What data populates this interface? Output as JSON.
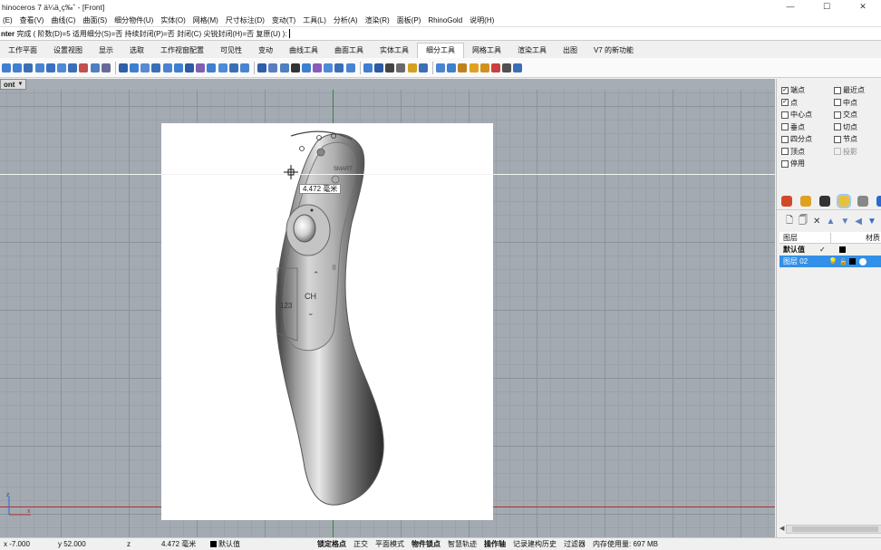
{
  "window": {
    "title": "hinoceros 7 ä¼ä¸ç‰ˆ - [Front]",
    "controls": {
      "minimize": "—",
      "maximize": "☐",
      "close": "✕"
    }
  },
  "menubar": [
    "(E)",
    "查看(V)",
    "曲线(C)",
    "曲面(S)",
    "细分物件(U)",
    "实体(O)",
    "网格(M)",
    "尺寸标注(D)",
    "变动(T)",
    "工具(L)",
    "分析(A)",
    "渲染(R)",
    "面板(P)",
    "RhinoGold",
    "说明(H)"
  ],
  "command": {
    "name": "nter",
    "text": " 完成 ( 阶数(D)=5 适用细分(S)=否 持续封闭(P)=否 封闭(C) 尖锐封闭(H)=否 复原(U) ):"
  },
  "tabs": [
    {
      "label": "工作平面",
      "active": false
    },
    {
      "label": "设置视图",
      "active": false
    },
    {
      "label": "显示",
      "active": false
    },
    {
      "label": "选取",
      "active": false
    },
    {
      "label": "工作视窗配置",
      "active": false
    },
    {
      "label": "可见性",
      "active": false
    },
    {
      "label": "变动",
      "active": false
    },
    {
      "label": "曲线工具",
      "active": false
    },
    {
      "label": "曲面工具",
      "active": false
    },
    {
      "label": "实体工具",
      "active": false
    },
    {
      "label": "细分工具",
      "active": true
    },
    {
      "label": "网格工具",
      "active": false
    },
    {
      "label": "渲染工具",
      "active": false
    },
    {
      "label": "出图",
      "active": false
    },
    {
      "label": "V7 的新功能",
      "active": false
    }
  ],
  "toolbar_icon_colors": [
    "#3f7fcf",
    "#3f7fcf",
    "#3b6fb5",
    "#4a84d0",
    "#3a70c0",
    "#4e8ad6",
    "#3b6fb5",
    "#c05050",
    "#4f7fc0",
    "#6a6a9a",
    "#2e5fa8",
    "#3f7fcf",
    "#5a8ad0",
    "#3b6fb5",
    "#4a84d0",
    "#3f7fcf",
    "#2d5aa0",
    "#8060b0",
    "#3f7fcf",
    "#4e8ad6",
    "#3b6fb5",
    "#4a84d0",
    "#2e5fa8",
    "#5a7fc0",
    "#4f7fc0",
    "#333333",
    "#3f7fcf",
    "#8a5ab8",
    "#4e8ad6",
    "#3b6fb5",
    "#4a84d0",
    "#3f7fcf",
    "#2d5aa0",
    "#444444",
    "#6a6a6a",
    "#d4a020",
    "#3b6fb5",
    "#4a84d0",
    "#3f7fcf",
    "#c08020",
    "#e0a020",
    "#d09020",
    "#c84040",
    "#505050",
    "#3b6fb5"
  ],
  "viewport": {
    "name": "ont",
    "tooltip": "4.472 毫米",
    "axis_labels": {
      "z": "z",
      "x": "x"
    }
  },
  "colors": {
    "viewport_bg": "#a3aab1",
    "axis_x": "#a83232",
    "axis_y": "#2f8a3a",
    "selection": "#3390e8"
  },
  "osnap": [
    {
      "label": "端点",
      "checked": true,
      "disabled": false
    },
    {
      "label": "最近点",
      "checked": false,
      "disabled": false
    },
    {
      "label": "点",
      "checked": true,
      "disabled": false
    },
    {
      "label": "中点",
      "checked": false,
      "disabled": false
    },
    {
      "label": "中心点",
      "checked": false,
      "disabled": false
    },
    {
      "label": "交点",
      "checked": false,
      "disabled": false
    },
    {
      "label": "垂点",
      "checked": false,
      "disabled": false
    },
    {
      "label": "切点",
      "checked": false,
      "disabled": false
    },
    {
      "label": "四分点",
      "checked": false,
      "disabled": false
    },
    {
      "label": "节点",
      "checked": false,
      "disabled": false
    },
    {
      "label": "顶点",
      "checked": false,
      "disabled": false
    },
    {
      "label": "投影",
      "checked": false,
      "disabled": true
    },
    {
      "label": "停用",
      "checked": false,
      "disabled": false
    }
  ],
  "panel_tabs": [
    "properties-icon",
    "render-icon",
    "display-icon",
    "light-icon",
    "help-icon",
    "extra-icon"
  ],
  "layers": {
    "columns": [
      "图层",
      "材质"
    ],
    "rows": [
      {
        "name": "默认值",
        "current": true,
        "selected": false
      },
      {
        "name": "图层 02",
        "current": false,
        "selected": true
      }
    ],
    "current_mark": "✓"
  },
  "status": {
    "x": "x -7.000",
    "y": "y 52.000",
    "z": "z",
    "distance": "4.472 毫米",
    "layer": "默认值",
    "toggles": [
      {
        "label": "锁定格点",
        "bold": true
      },
      {
        "label": "正交",
        "bold": false
      },
      {
        "label": "平面模式",
        "bold": false
      },
      {
        "label": "物件锁点",
        "bold": true
      },
      {
        "label": "智慧轨迹",
        "bold": false
      },
      {
        "label": "操作轴",
        "bold": true
      },
      {
        "label": "记录建构历史",
        "bold": false
      },
      {
        "label": "过滤器",
        "bold": false
      }
    ],
    "memory": "内存使用量: 697 MB"
  },
  "remote": {
    "smart_label": "SMART",
    "ch_label": "CH",
    "num_label": "123"
  }
}
